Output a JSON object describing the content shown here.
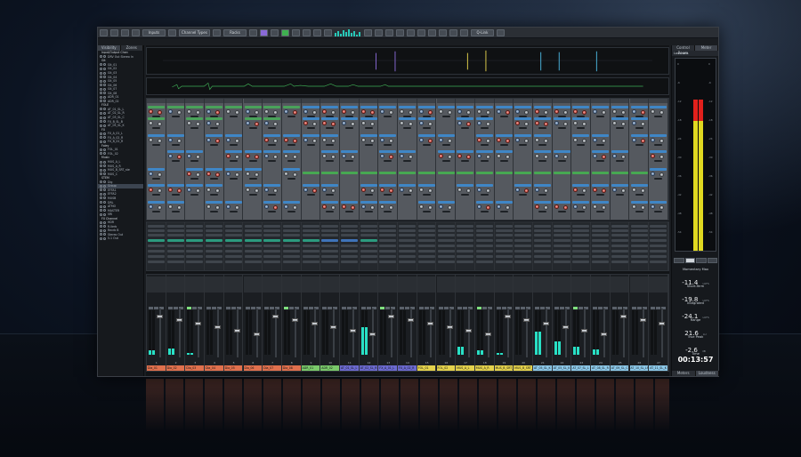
{
  "toolbar": {
    "buttons": [
      "",
      "",
      "",
      "",
      "Inputs",
      "",
      "Channel Types",
      "",
      "Racks",
      "",
      "",
      "",
      "",
      "",
      "",
      "",
      "",
      "",
      "",
      "",
      "",
      "",
      "",
      "",
      "",
      "",
      "",
      "Q-Link",
      ""
    ]
  },
  "left_zone": {
    "tabs": [
      "Visibility",
      "Zones"
    ],
    "tree": [
      {
        "label": "Input/Output Chan",
        "type": "folder"
      },
      {
        "label": "DRV Out Stereo In",
        "type": "item"
      },
      {
        "label": "Git",
        "type": "folder"
      },
      {
        "label": "Git_01",
        "type": "item"
      },
      {
        "label": "Git_02",
        "type": "item"
      },
      {
        "label": "Git_03",
        "type": "item"
      },
      {
        "label": "Git_04",
        "type": "item"
      },
      {
        "label": "Git_05",
        "type": "item"
      },
      {
        "label": "Git_06",
        "type": "item"
      },
      {
        "label": "Git_07",
        "type": "item"
      },
      {
        "label": "Git_08",
        "type": "item"
      },
      {
        "label": "ADR_01",
        "type": "item"
      },
      {
        "label": "ADR_02",
        "type": "item"
      },
      {
        "label": "FOLE",
        "type": "folder"
      },
      {
        "label": "AT_01_SL_L",
        "type": "item"
      },
      {
        "label": "AT_02_SL_R",
        "type": "item"
      },
      {
        "label": "AT_03_SL_C",
        "type": "item"
      },
      {
        "label": "FX_B_SL_B",
        "type": "item"
      },
      {
        "label": "AT_05_SL_K",
        "type": "item"
      },
      {
        "label": "FX",
        "type": "folder"
      },
      {
        "label": "FX_A_01_L",
        "type": "item"
      },
      {
        "label": "FX_A_02_R",
        "type": "item"
      },
      {
        "label": "FX_B_02_R",
        "type": "item"
      },
      {
        "label": "Foley",
        "type": "folder"
      },
      {
        "label": "FOL_01",
        "type": "item"
      },
      {
        "label": "FOL_02",
        "type": "item"
      },
      {
        "label": "Music",
        "type": "folder"
      },
      {
        "label": "MUS_A_L",
        "type": "item"
      },
      {
        "label": "MUS_A_R",
        "type": "item"
      },
      {
        "label": "MUS_B_SRT_ste",
        "type": "item"
      },
      {
        "label": "MUS_C",
        "type": "item"
      },
      {
        "label": "STEM",
        "type": "folder"
      },
      {
        "label": "Dlg",
        "type": "item"
      },
      {
        "label": "Group",
        "type": "item",
        "selected": true
      },
      {
        "label": "EFFA1",
        "type": "item"
      },
      {
        "label": "EFFA2",
        "type": "item"
      },
      {
        "label": "MUSB",
        "type": "item"
      },
      {
        "label": "DRL",
        "type": "item"
      },
      {
        "label": "ATMO",
        "type": "item"
      },
      {
        "label": "MASTER",
        "type": "item"
      },
      {
        "label": "VRI",
        "type": "item"
      },
      {
        "label": "FX Channel",
        "type": "folder"
      },
      {
        "label": "HDR",
        "type": "item"
      },
      {
        "label": "R-Verb",
        "type": "item"
      },
      {
        "label": "Revrb B",
        "type": "item"
      },
      {
        "label": "Stereo Out",
        "type": "item"
      },
      {
        "label": "5.1 Out",
        "type": "item"
      }
    ]
  },
  "right_zone": {
    "tabs": [
      "Control Room",
      "Meter"
    ],
    "header": "Loudness",
    "controls": [
      "",
      "",
      "",
      ""
    ],
    "stats": [
      {
        "label": "Momentary Max",
        "value": "-11.4",
        "unit": "LUFS"
      },
      {
        "label": "Short-Term",
        "value": "-19.8",
        "unit": "LUFS"
      },
      {
        "label": "Integrated",
        "value": "-24.1",
        "unit": "LUFS"
      },
      {
        "label": "Range",
        "value": "21.6",
        "unit": "LU"
      },
      {
        "label": "True Peak",
        "value": "-2.6",
        "unit": "dB"
      }
    ],
    "time_label": "Time",
    "time_value": "00:13:57",
    "foot_tabs": [
      "Meters",
      "Loudness"
    ]
  },
  "channels": [
    {
      "name": "Dia_01",
      "color": "#e0704d",
      "num": "1",
      "level": 0.1
    },
    {
      "name": "Dia_02",
      "color": "#e0704d",
      "num": "2",
      "level": 0.15
    },
    {
      "name": "Dia_03",
      "color": "#e0704d",
      "num": "3",
      "level": 0.05
    },
    {
      "name": "Dia_04",
      "color": "#e0704d",
      "num": "4",
      "level": 0.0
    },
    {
      "name": "Dia_05",
      "color": "#e0704d",
      "num": "5",
      "level": 0.0
    },
    {
      "name": "Dia_06",
      "color": "#e0704d",
      "num": "6",
      "level": 0.0
    },
    {
      "name": "Dia_07",
      "color": "#e0704d",
      "num": "7",
      "level": 0.0
    },
    {
      "name": "Dia_08",
      "color": "#e0704d",
      "num": "8",
      "level": 0.0
    },
    {
      "name": "ADR_01",
      "color": "#7ac96a",
      "num": "9",
      "level": 0.0
    },
    {
      "name": "ADR_02",
      "color": "#7ac96a",
      "num": "10",
      "level": 0.0
    },
    {
      "name": "AT_01_SL_L",
      "color": "#6c6ad0",
      "num": "11",
      "level": 0.0
    },
    {
      "name": "AT_02_SL_R",
      "color": "#6c6ad0",
      "num": "12",
      "level": 0.62
    },
    {
      "name": "FX_A_01_L",
      "color": "#6c6ad0",
      "num": "13",
      "level": 0.0
    },
    {
      "name": "FX_A_02_R",
      "color": "#6c6ad0",
      "num": "14",
      "level": 0.0
    },
    {
      "name": "FOL_01",
      "color": "#e4d24c",
      "num": "15",
      "level": 0.0
    },
    {
      "name": "FOL_02",
      "color": "#e4d24c",
      "num": "16",
      "level": 0.0
    },
    {
      "name": "MUS_A_L",
      "color": "#e4d24c",
      "num": "17",
      "level": 0.18
    },
    {
      "name": "MUS_A_R",
      "color": "#e4d24c",
      "num": "18",
      "level": 0.1
    },
    {
      "name": "MUS_B_SRT_ste",
      "color": "#e4d24c",
      "num": "19",
      "level": 0.05
    },
    {
      "name": "MUS_B_SRT_ste",
      "color": "#e4d24c",
      "num": "20",
      "level": 0.0
    },
    {
      "name": "AT_05_SL_K",
      "color": "#8cc8e8",
      "num": "21",
      "level": 0.52
    },
    {
      "name": "AT_05_SL_K",
      "color": "#8cc8e8",
      "num": "22",
      "level": 0.3
    },
    {
      "name": "AT_07_SL_L",
      "color": "#8cc8e8",
      "num": "23",
      "level": 0.18
    },
    {
      "name": "AT_08_SL_R",
      "color": "#8cc8e8",
      "num": "24",
      "level": 0.12
    },
    {
      "name": "AT_09_SL_C",
      "color": "#8cc8e8",
      "num": "25",
      "level": 0.0
    },
    {
      "name": "AT_10_SL_LFE",
      "color": "#8cc8e8",
      "num": "26",
      "level": 0.0
    },
    {
      "name": "AT_11_SL_K",
      "color": "#8cc8e8",
      "num": "27",
      "level": 0.0
    }
  ],
  "meter": {
    "scale": [
      "0",
      "-6",
      "-12",
      "-18",
      "-24",
      "-30",
      "-36",
      "-42",
      "-48",
      "-54"
    ]
  }
}
